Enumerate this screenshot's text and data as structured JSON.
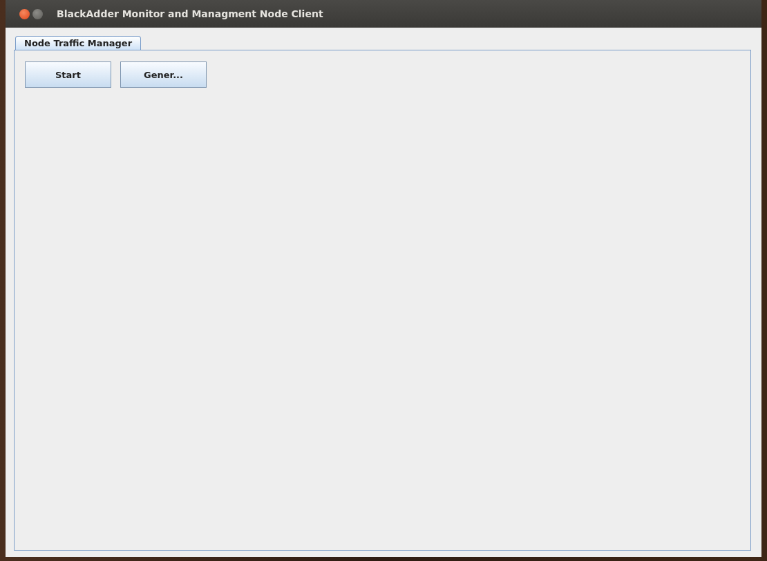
{
  "window": {
    "title": "BlackAdder Monitor and Managment Node Client"
  },
  "tabs": [
    {
      "label": "Node Traffic Manager",
      "selected": true
    }
  ],
  "buttons": [
    "Start",
    "Gener..."
  ]
}
